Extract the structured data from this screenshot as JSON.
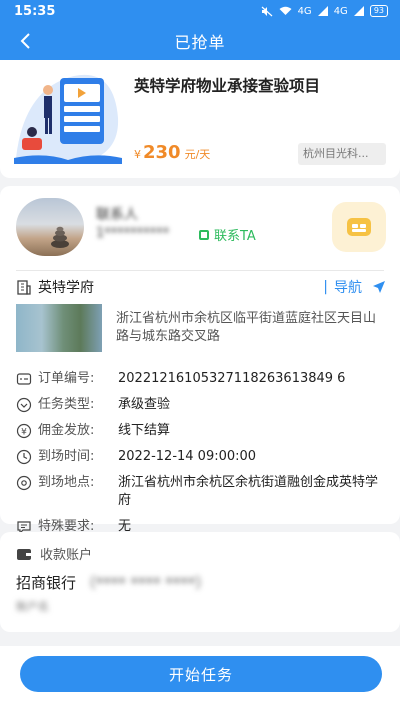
{
  "status_bar": {
    "time": "15:35",
    "signal_1": "4G",
    "signal_2": "4G",
    "battery": "93"
  },
  "nav": {
    "title": "已抢单"
  },
  "task": {
    "title": "英特学府物业承接查验项目",
    "currency": "¥",
    "price": "230",
    "unit": "元/天",
    "company": "杭州目光科..."
  },
  "contact": {
    "name": "联系人",
    "phone": "1**********",
    "link_label": "联系TA"
  },
  "place": {
    "name": "英特学府",
    "nav_label": "导航",
    "address": "浙江省杭州市余杭区临平街道蓝庭社区天目山路与城东路交叉路"
  },
  "info": [
    {
      "label": "订单编号:",
      "value": "20221216105327118263613849 6"
    },
    {
      "label": "任务类型:",
      "value": "承级查验"
    },
    {
      "label": "佣金发放:",
      "value": "线下结算"
    },
    {
      "label": "到场时间:",
      "value": "2022-12-14 09:00:00"
    },
    {
      "label": "到场地点:",
      "value": "浙江省杭州市余杭区余杭街道融创金成英特学府"
    },
    {
      "label": "特殊要求:",
      "value": "无"
    }
  ],
  "account": {
    "heading": "收款账户",
    "bank": "招商银行",
    "bank_blurred": "（**** **** ****）",
    "holder_blurred": "账户名"
  },
  "footer": {
    "start_label": "开始任务"
  },
  "colors": {
    "primary": "#2f8ff0",
    "price": "#f08a28",
    "contact": "#2dbb5d"
  }
}
